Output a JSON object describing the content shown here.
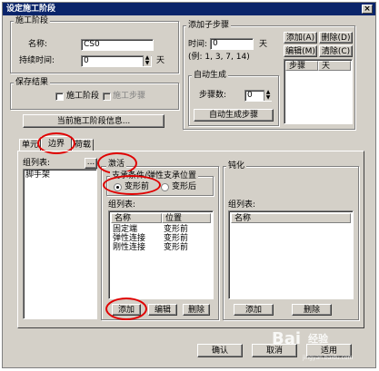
{
  "window": {
    "title": "设定施工阶段",
    "close": "×"
  },
  "stage": {
    "group_label": "施工阶段",
    "name_label": "名称:",
    "name_value": "CS0",
    "duration_label": "持续时间:",
    "duration_value": "0",
    "duration_unit": "天"
  },
  "substep": {
    "group_label": "添加子步骤",
    "time_label": "时间:",
    "time_value": "0",
    "time_unit": "天",
    "example": "(例: 1, 3, 7, 14)",
    "add_button": "添加(A)",
    "delete_button": "删除(D)",
    "edit_button": "编辑(M)",
    "clear_button": "清除(C)",
    "columns": [
      "步骤",
      "天"
    ],
    "auto_group_label": "自动生成",
    "step_count_label": "步骤数:",
    "step_count_value": "0",
    "auto_generate_button": "自动生成步骤"
  },
  "save_result": {
    "group_label": "保存结果",
    "stage_checkbox": "施工阶段",
    "step_checkbox": "施工步骤"
  },
  "current_stage_info_button": "当前施工阶段信息...",
  "tabs": [
    "单元",
    "边界",
    "荷载"
  ],
  "left_panel": {
    "list_label": "组列表:",
    "browse_button": "...",
    "items": [
      "脚手架"
    ]
  },
  "activate_panel": {
    "group_label": "激活",
    "support_group_label": "支承条件/弹性支承位置",
    "radio_before": "变形前",
    "radio_after": "变形后",
    "list_label": "组列表:",
    "columns": [
      "名称",
      "位置"
    ],
    "rows": [
      [
        "固定端",
        "变形前"
      ],
      [
        "弹性连接",
        "变形前"
      ],
      [
        "刚性连接",
        "变形前"
      ]
    ],
    "add_button": "添加",
    "edit_button": "编辑",
    "delete_button": "删除"
  },
  "deactivate_panel": {
    "group_label": "钝化",
    "list_label": "组列表:",
    "columns": [
      "名称"
    ],
    "add_button": "添加",
    "delete_button": "删除"
  },
  "footer": {
    "ok_button": "确认",
    "cancel_button": "取消",
    "apply_button": "适用"
  },
  "watermark": {
    "brand": "Bai",
    "brand_suffix": "经验",
    "url": "jingyan.baidu.com"
  },
  "colors": {
    "highlight_circle": "#e00000",
    "titlebar": "#0a246a",
    "face": "#d4d0c8"
  }
}
